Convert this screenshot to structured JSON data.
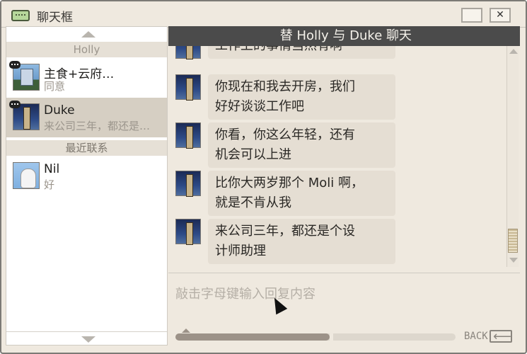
{
  "window": {
    "title": "聊天框"
  },
  "sidebar": {
    "groups": [
      {
        "header": "Holly"
      },
      {
        "header": "最近联系"
      }
    ],
    "contacts": [
      {
        "name": "主食+云府…",
        "last_message": "同意",
        "avatar": "city-building-avatar",
        "badge": "chat-badge-icon"
      },
      {
        "name": "Duke",
        "last_message": "来公司三年，都还是…",
        "avatar": "night-figure-avatar",
        "badge": "chat-badge-icon",
        "selected": true
      },
      {
        "name": "Nil",
        "last_message": "好",
        "avatar": "seagull-avatar"
      }
    ]
  },
  "chat": {
    "header": "替 Holly 与 Duke 聊天",
    "messages": [
      {
        "text": "工作上的事情当然有啊"
      },
      {
        "text": "你现在和我去开房，我们\n好好谈谈工作吧"
      },
      {
        "text": "你看，你这么年轻，还有\n机会可以上进"
      },
      {
        "text": "比你大两岁那个 Moli 啊，\n就是不肯从我"
      },
      {
        "text": "来公司三年，都还是个设\n计师助理"
      }
    ]
  },
  "input": {
    "placeholder": "敲击字母键输入回复内容",
    "value": ""
  },
  "footer": {
    "back_label": "BACK",
    "progress": 0.55
  },
  "colors": {
    "header_bg": "#4b4b4b",
    "bubble_bg": "#e5ded3",
    "selected_row": "#d6cfc3",
    "window_bg": "#efe9df"
  }
}
